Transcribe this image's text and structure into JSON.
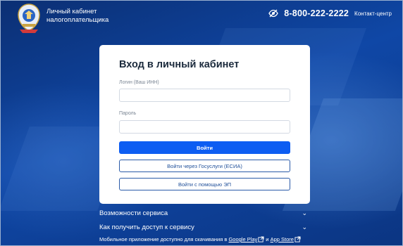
{
  "header": {
    "brand_line1": "Личный кабинет",
    "brand_line2": "налогоплательщика",
    "phone": "8-800-222-2222",
    "contact_label": "Контакт-центр",
    "icons": {
      "logo": "fns-emblem-icon",
      "accessibility": "eye-slash-icon"
    }
  },
  "login": {
    "title": "Вход в личный кабинет",
    "login_label": "Логин (Ваш ИНН)",
    "login_value": "",
    "password_label": "Пароль",
    "password_value": "",
    "submit_label": "Войти",
    "gosuslugi_label": "Войти через Госуслуги (ЕСИА)",
    "ep_label": "Войти с помощью ЭП"
  },
  "accordion": {
    "items": [
      {
        "label": "Возможности сервиса",
        "icon": "chevron-down-icon"
      },
      {
        "label": "Как получить доступ к сервису",
        "icon": "chevron-down-icon"
      }
    ]
  },
  "footer": {
    "text": "Мобильное приложение доступно для скачивания в",
    "google_play": "Google Play",
    "conj": "и",
    "app_store": "App Store",
    "icon": "external-link-icon"
  },
  "colors": {
    "background": "#0d3a86",
    "primary_button": "#0d5df2",
    "outline_button_border": "#2a5aa8",
    "card": "#ffffff"
  }
}
